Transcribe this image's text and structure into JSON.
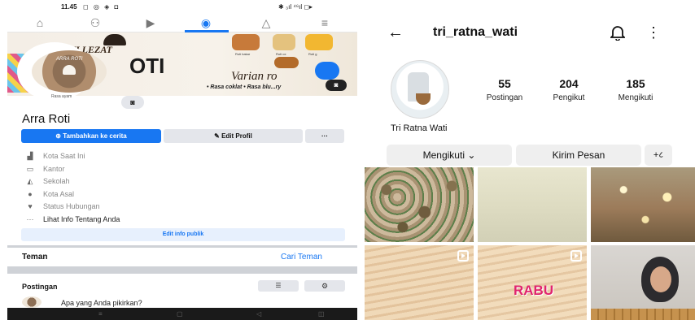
{
  "facebook": {
    "status_bar": {
      "time": "11.45",
      "icons": "◻ ◎ ◈ ◘",
      "right": "✱ ₃ıl ⁴⁶ıl ◻▸"
    },
    "nav": {
      "icons": [
        "home-icon",
        "friends-icon",
        "video-icon",
        "profile-icon",
        "bell-icon",
        "menu-icon"
      ]
    },
    "cover": {
      "title": "ROTI LEZAT",
      "big_text": "OTI",
      "varian": "Varian ro",
      "list": "• Rasa coklat  • Rasa blu...ry",
      "bread_labels": [
        "Roti bakar",
        "Roti ox",
        "Roti g"
      ]
    },
    "avatar": {
      "brand": "ARRA ROTI",
      "caption": "Rasa ayam"
    },
    "profile_name": "Arra Roti",
    "buttons": {
      "add_story": "Tambahkan ke cerita",
      "edit_profile": "Edit Profil",
      "more": "···"
    },
    "info_rows": [
      {
        "icon": "building-icon",
        "label": "Kota Saat Ini"
      },
      {
        "icon": "briefcase-icon",
        "label": "Kantor"
      },
      {
        "icon": "graduation-cap-icon",
        "label": "Sekolah"
      },
      {
        "icon": "location-pin-icon",
        "label": "Kota Asal"
      },
      {
        "icon": "heart-icon",
        "label": "Status Hubungan"
      },
      {
        "icon": "more-dots-icon",
        "label": "Lihat Info Tentang Anda"
      }
    ],
    "edit_public": "Edit info publik",
    "friends": {
      "title": "Teman",
      "find": "Cari Teman"
    },
    "posts": {
      "title": "Postingan",
      "compose_placeholder": "Apa yang Anda pikirkan?"
    }
  },
  "instagram": {
    "username": "tri_ratna_wati",
    "full_name": "Tri Ratna Wati",
    "stats": [
      {
        "value": "55",
        "label": "Postingan"
      },
      {
        "value": "204",
        "label": "Pengikut"
      },
      {
        "value": "185",
        "label": "Mengikuti"
      }
    ],
    "buttons": {
      "following": "Mengikuti ⌄",
      "message": "Kirim Pesan",
      "add": "+८"
    },
    "grid": [
      {
        "name": "grid-post-1",
        "reel": false,
        "overlay": ""
      },
      {
        "name": "grid-post-2",
        "reel": false,
        "overlay": ""
      },
      {
        "name": "grid-post-3",
        "reel": false,
        "overlay": ""
      },
      {
        "name": "grid-post-4",
        "reel": true,
        "overlay": ""
      },
      {
        "name": "grid-post-5",
        "reel": true,
        "overlay": "RABU"
      },
      {
        "name": "grid-post-6",
        "reel": false,
        "overlay": ""
      }
    ]
  },
  "colors": {
    "facebook_blue": "#1877f2",
    "button_grey": "#e4e6eb",
    "ig_button_grey": "#efefef",
    "rabu_pink": "#e0246e"
  }
}
